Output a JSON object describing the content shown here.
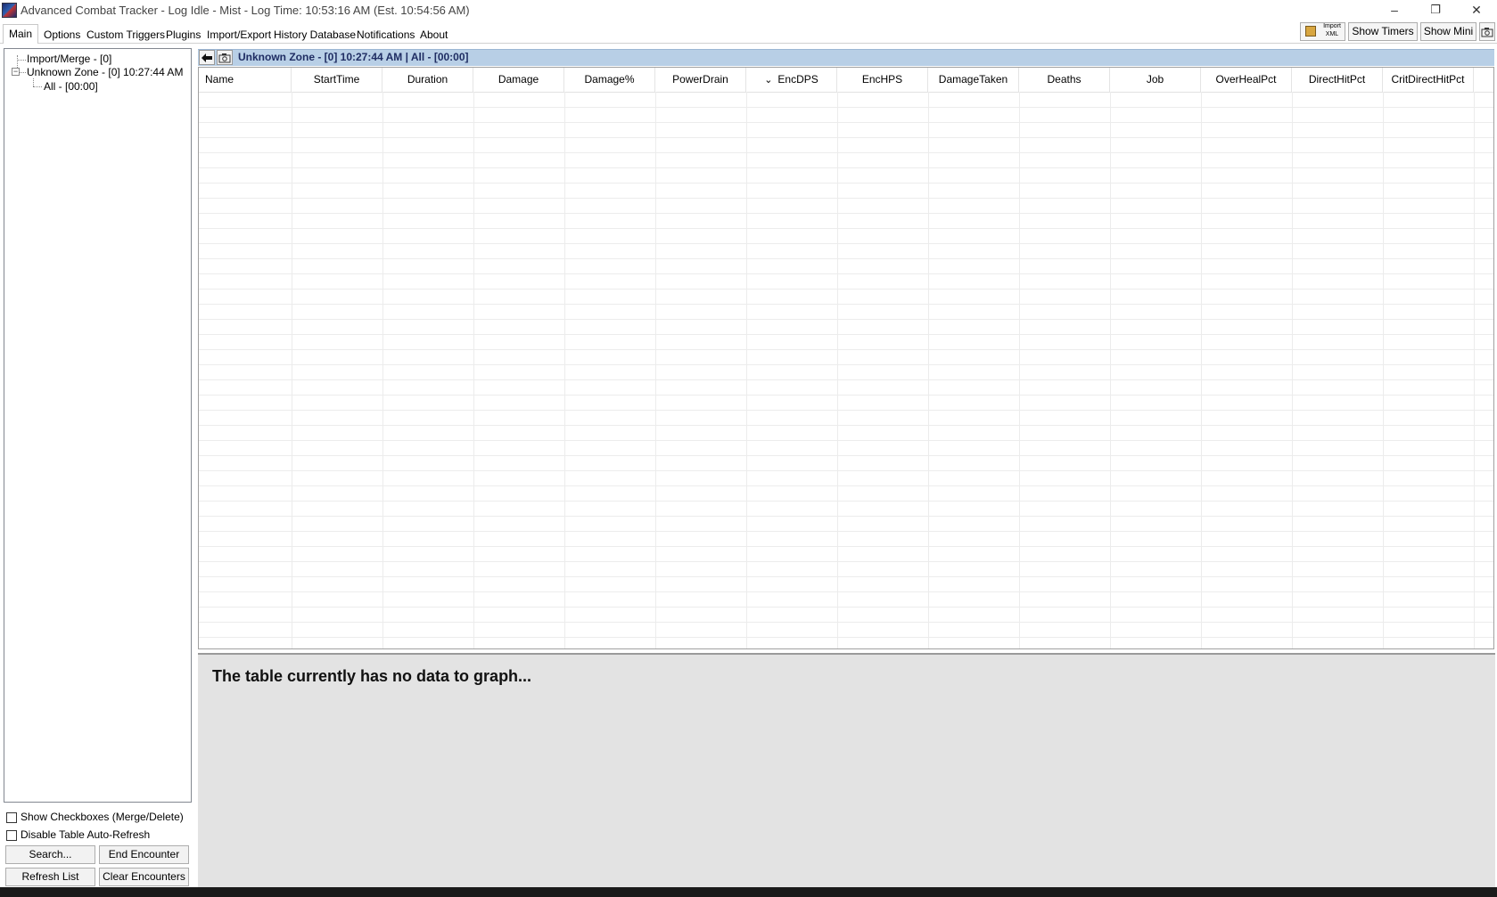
{
  "window": {
    "title": "Advanced Combat Tracker - Log Idle - Mist - Log Time: 10:53:16 AM (Est. 10:54:56 AM)",
    "minimize_glyph": "–",
    "restore_glyph": "❐",
    "close_glyph": "✕"
  },
  "menu": {
    "tabs": [
      "Main",
      "Options",
      "Custom Triggers",
      "Plugins",
      "Import/Export",
      "History Database",
      "Notifications",
      "About"
    ]
  },
  "toolbar": {
    "import_xml_line1": "Import",
    "import_xml_line2": "XML",
    "show_timers": "Show Timers",
    "show_mini": "Show Mini"
  },
  "tree": {
    "items": [
      "Import/Merge - [0]",
      "Unknown Zone - [0] 10:27:44 AM",
      "All - [00:00]"
    ]
  },
  "options": {
    "show_checkboxes": "Show Checkboxes (Merge/Delete)",
    "disable_autorefresh": "Disable Table Auto-Refresh"
  },
  "buttons": {
    "search": "Search...",
    "end_encounter": "End Encounter",
    "refresh_list": "Refresh List",
    "clear_encounters": "Clear Encounters"
  },
  "encounter": {
    "title": "Unknown Zone - [0] 10:27:44 AM | All - [00:00]"
  },
  "table": {
    "columns": [
      "Name",
      "StartTime",
      "Duration",
      "Damage",
      "Damage%",
      "PowerDrain",
      "EncDPS",
      "EncHPS",
      "DamageTaken",
      "Deaths",
      "Job",
      "OverHealPct",
      "DirectHitPct",
      "CritDirectHitPct"
    ],
    "sort_column": "EncDPS",
    "sort_glyph": "⌄",
    "rows": []
  },
  "graph": {
    "message": "The table currently has no data to graph..."
  }
}
